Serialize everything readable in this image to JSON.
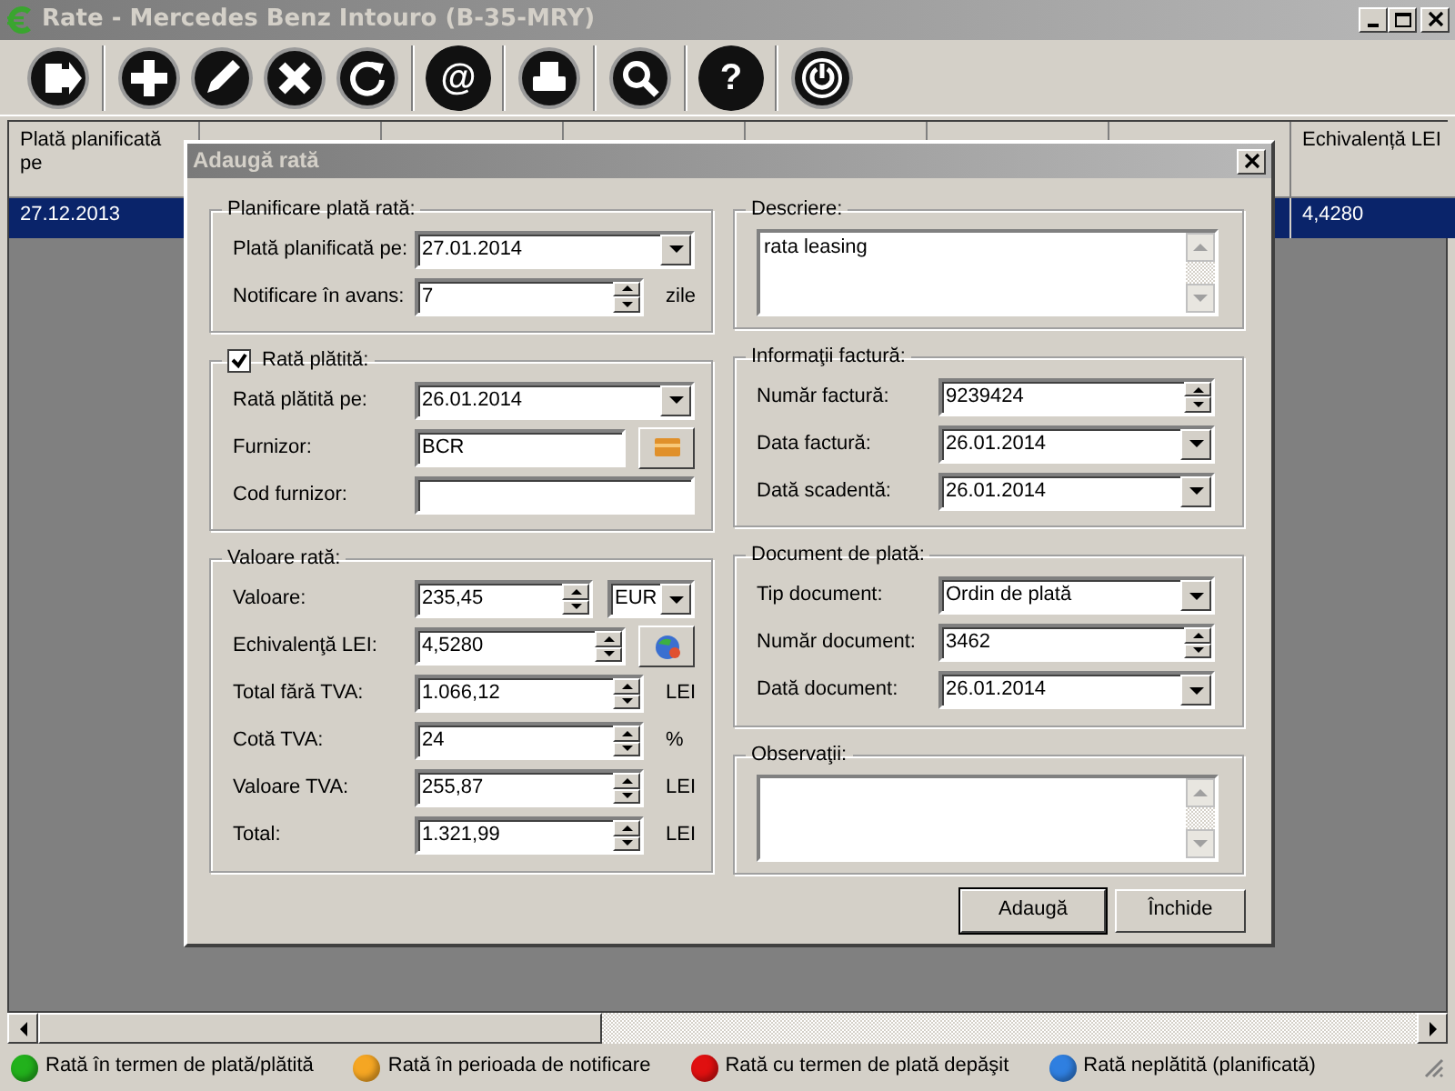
{
  "window": {
    "title": "Rate - Mercedes Benz Intouro (B-35-MRY)"
  },
  "toolbar": [
    [
      {
        "kind": "exit"
      }
    ],
    [
      {
        "kind": "add"
      },
      {
        "kind": "edit"
      },
      {
        "kind": "delete"
      },
      {
        "kind": "refresh"
      }
    ],
    [
      {
        "kind": "glyph",
        "text": "@"
      }
    ],
    [
      {
        "kind": "print"
      }
    ],
    [
      {
        "kind": "search"
      }
    ],
    [
      {
        "kind": "glyph",
        "text": "?"
      }
    ],
    [
      {
        "kind": "power"
      }
    ]
  ],
  "grid": {
    "columns": [
      "Plată planificată pe",
      "Echivalență LEI"
    ],
    "rows": [
      {
        "selected": true,
        "cells": [
          "27.12.2013",
          "4,4280"
        ]
      }
    ]
  },
  "dialog": {
    "title": "Adaugă rată",
    "left_groups": [
      {
        "title": "Planificare plată rată:",
        "fields": [
          {
            "label": "Plată planificată pe:",
            "kind": "combo",
            "value": "27.01.2014"
          },
          {
            "label": "Notificare în avans:",
            "kind": "spin",
            "value": "7",
            "unit": "zile"
          }
        ]
      },
      {
        "title": "Rată plătită:",
        "checked": true,
        "fields": [
          {
            "label": "Rată plătită pe:",
            "kind": "combo",
            "value": "26.01.2014"
          },
          {
            "label": "Furnizor:",
            "kind": "text",
            "value": "BCR",
            "extra": {
              "kind": "pick-button"
            }
          },
          {
            "label": "Cod furnizor:",
            "kind": "text"
          }
        ]
      },
      {
        "title": "Valoare rată:",
        "fields": [
          {
            "label": "Valoare:",
            "kind": "spin",
            "value": "235,45",
            "extra": {
              "kind": "combo",
              "value": "EUR"
            }
          },
          {
            "label": "Echivalenţă LEI:",
            "kind": "spin",
            "value": "4,5280",
            "extra": {
              "kind": "rate-button"
            }
          },
          {
            "label": "Total fără TVA:",
            "kind": "spin",
            "value": "1.066,12",
            "unit": "LEI"
          },
          {
            "label": "Cotă TVA:",
            "kind": "spin",
            "value": "24",
            "unit": "%"
          },
          {
            "label": "Valoare TVA:",
            "kind": "spin",
            "value": "255,87",
            "unit": "LEI"
          },
          {
            "label": "Total:",
            "kind": "spin",
            "value": "1.321,99",
            "unit": "LEI"
          }
        ]
      }
    ],
    "right_groups": [
      {
        "title": "Descriere:",
        "fields": [
          {
            "kind": "memo",
            "value": "rata leasing"
          }
        ]
      },
      {
        "title": "Informaţii factură:",
        "fields": [
          {
            "label": "Număr factură:",
            "kind": "spin",
            "value": "9239424"
          },
          {
            "label": "Data factură:",
            "kind": "combo",
            "value": "26.01.2014"
          },
          {
            "label": "Dată scadentă:",
            "kind": "combo",
            "value": "26.01.2014"
          }
        ]
      },
      {
        "title": "Document de plată:",
        "fields": [
          {
            "label": "Tip document:",
            "kind": "combo",
            "value": "Ordin de plată"
          },
          {
            "label": "Număr document:",
            "kind": "spin",
            "value": "3462"
          },
          {
            "label": "Dată document:",
            "kind": "combo",
            "value": "26.01.2014"
          }
        ]
      },
      {
        "title": "Observaţii:",
        "fields": [
          {
            "kind": "memo"
          }
        ]
      }
    ],
    "buttons": [
      {
        "label": "Adaugă",
        "default": true
      },
      {
        "label": "Închide",
        "default": false
      }
    ]
  },
  "legend": [
    {
      "label": "Rată în termen de plată/plătită",
      "color": "#22b11c"
    },
    {
      "label": "Rată în perioada de notificare",
      "color": "#f5a623"
    },
    {
      "label": "Rată cu termen de plată depăşit",
      "color": "#e01010"
    },
    {
      "label": "Rată neplătită (planificată)",
      "color": "#2f7fe0"
    }
  ]
}
